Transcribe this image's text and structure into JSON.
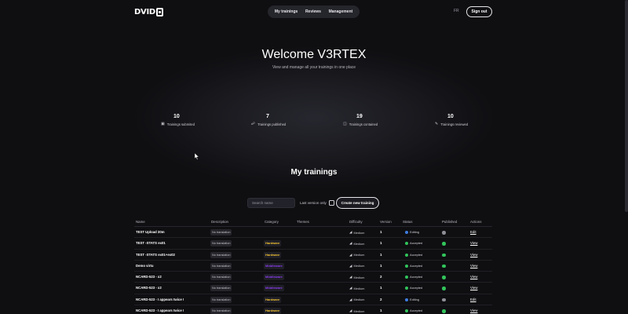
{
  "header": {
    "logo_text": "DVID",
    "nav": [
      "My trainings",
      "Reviews",
      "Management"
    ],
    "lang": "FR",
    "signout_label": "Sign out"
  },
  "hero": {
    "title": "Welcome V3RTEX",
    "subtitle": "View and manage all your trainings in one place"
  },
  "stats": [
    {
      "value": "10",
      "label": "Trainings submited",
      "icon": "upload-icon"
    },
    {
      "value": "7",
      "label": "Trainings published",
      "icon": "megaphone-icon"
    },
    {
      "value": "19",
      "label": "Trainings contained",
      "icon": "book-icon"
    },
    {
      "value": "10",
      "label": "Trainings reviewed",
      "icon": "edit-icon"
    }
  ],
  "trainings": {
    "title": "My trainings",
    "search_placeholder": "Search name",
    "last_version_label": "Last version only",
    "create_label": "Create new training",
    "columns": [
      "Name",
      "Description",
      "Category",
      "Themes",
      "Difficulty",
      "Version",
      "Status",
      "Published",
      "Actions"
    ],
    "rows": [
      {
        "name": "TEST Upload 30m",
        "desc": "No translation",
        "category": "",
        "difficulty": "Medium",
        "version": "1",
        "status": "Editing",
        "published": false,
        "action": "Edit"
      },
      {
        "name": "TEST -STATS ex01",
        "desc": "No translation",
        "category": "Hardware",
        "difficulty": "Medium",
        "version": "1",
        "status": "Accepted",
        "published": true,
        "action": "View"
      },
      {
        "name": "TEST -STATS ex01+ex02",
        "desc": "No translation",
        "category": "Hardware",
        "difficulty": "Medium",
        "version": "1",
        "status": "Accepted",
        "published": true,
        "action": "View"
      },
      {
        "name": "Demo virtu",
        "desc": "No translation",
        "category": "Middleware",
        "difficulty": "Medium",
        "version": "1",
        "status": "Accepted",
        "published": true,
        "action": "View"
      },
      {
        "name": "NCARD-523 - x2",
        "desc": "No translation",
        "category": "Middleware",
        "difficulty": "Medium",
        "version": "2",
        "status": "Accepted",
        "published": true,
        "action": "View"
      },
      {
        "name": "NCARD-523 - x2",
        "desc": "No translation",
        "category": "Middleware",
        "difficulty": "Medium",
        "version": "1",
        "status": "Accepted",
        "published": true,
        "action": "View"
      },
      {
        "name": "NCARD-523 - I appears twice !",
        "desc": "No translation",
        "category": "Hardware",
        "difficulty": "Medium",
        "version": "2",
        "status": "Editing",
        "published": false,
        "action": "Edit"
      },
      {
        "name": "NCARD-523 - I appears twice !",
        "desc": "No translation",
        "category": "Hardware",
        "difficulty": "Medium",
        "version": "1",
        "status": "Accepted",
        "published": true,
        "action": "View"
      }
    ]
  },
  "colors": {
    "hardware": "#f2c230",
    "middleware": "#8b3cf0",
    "editing": "#3f7de0",
    "accepted": "#31c45a",
    "published_on": "#31c45a",
    "published_off": "#8d8d96"
  }
}
